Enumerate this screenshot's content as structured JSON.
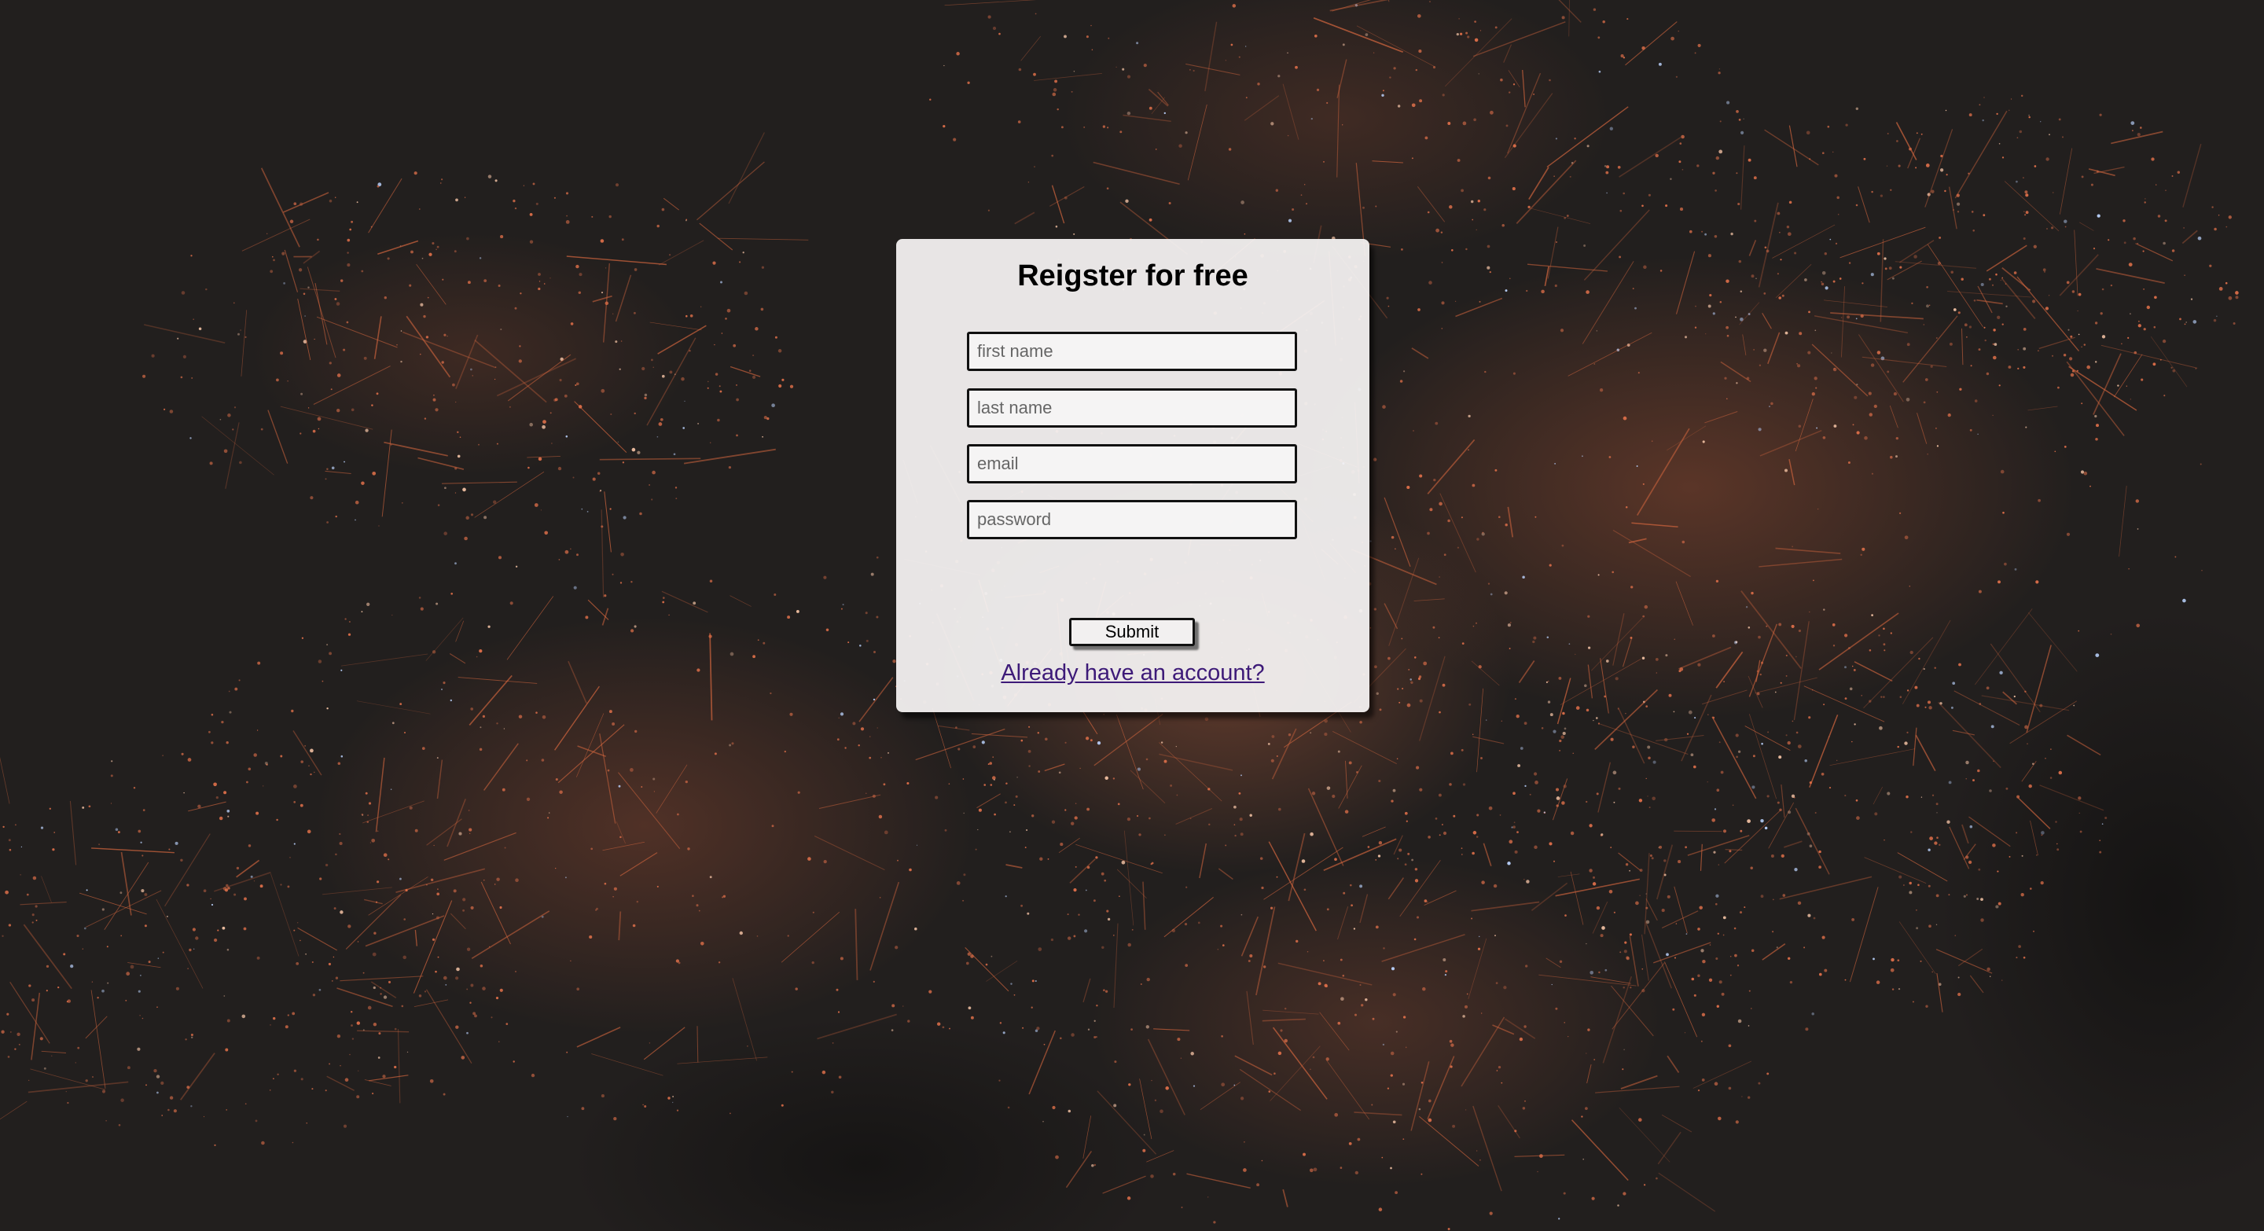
{
  "page": {
    "background": "night city lights aerial photo"
  },
  "colors": {
    "card": "#f4f2f2",
    "link": "#3d1a78",
    "background": "#221f1e",
    "lights": "#e0704a"
  },
  "form": {
    "title": "Reigster for free",
    "first_name_placeholder": "first name",
    "last_name_placeholder": "last name",
    "email_placeholder": "email",
    "password_placeholder": "password",
    "submit_label": "Submit",
    "login_link": "Already have an account?"
  }
}
